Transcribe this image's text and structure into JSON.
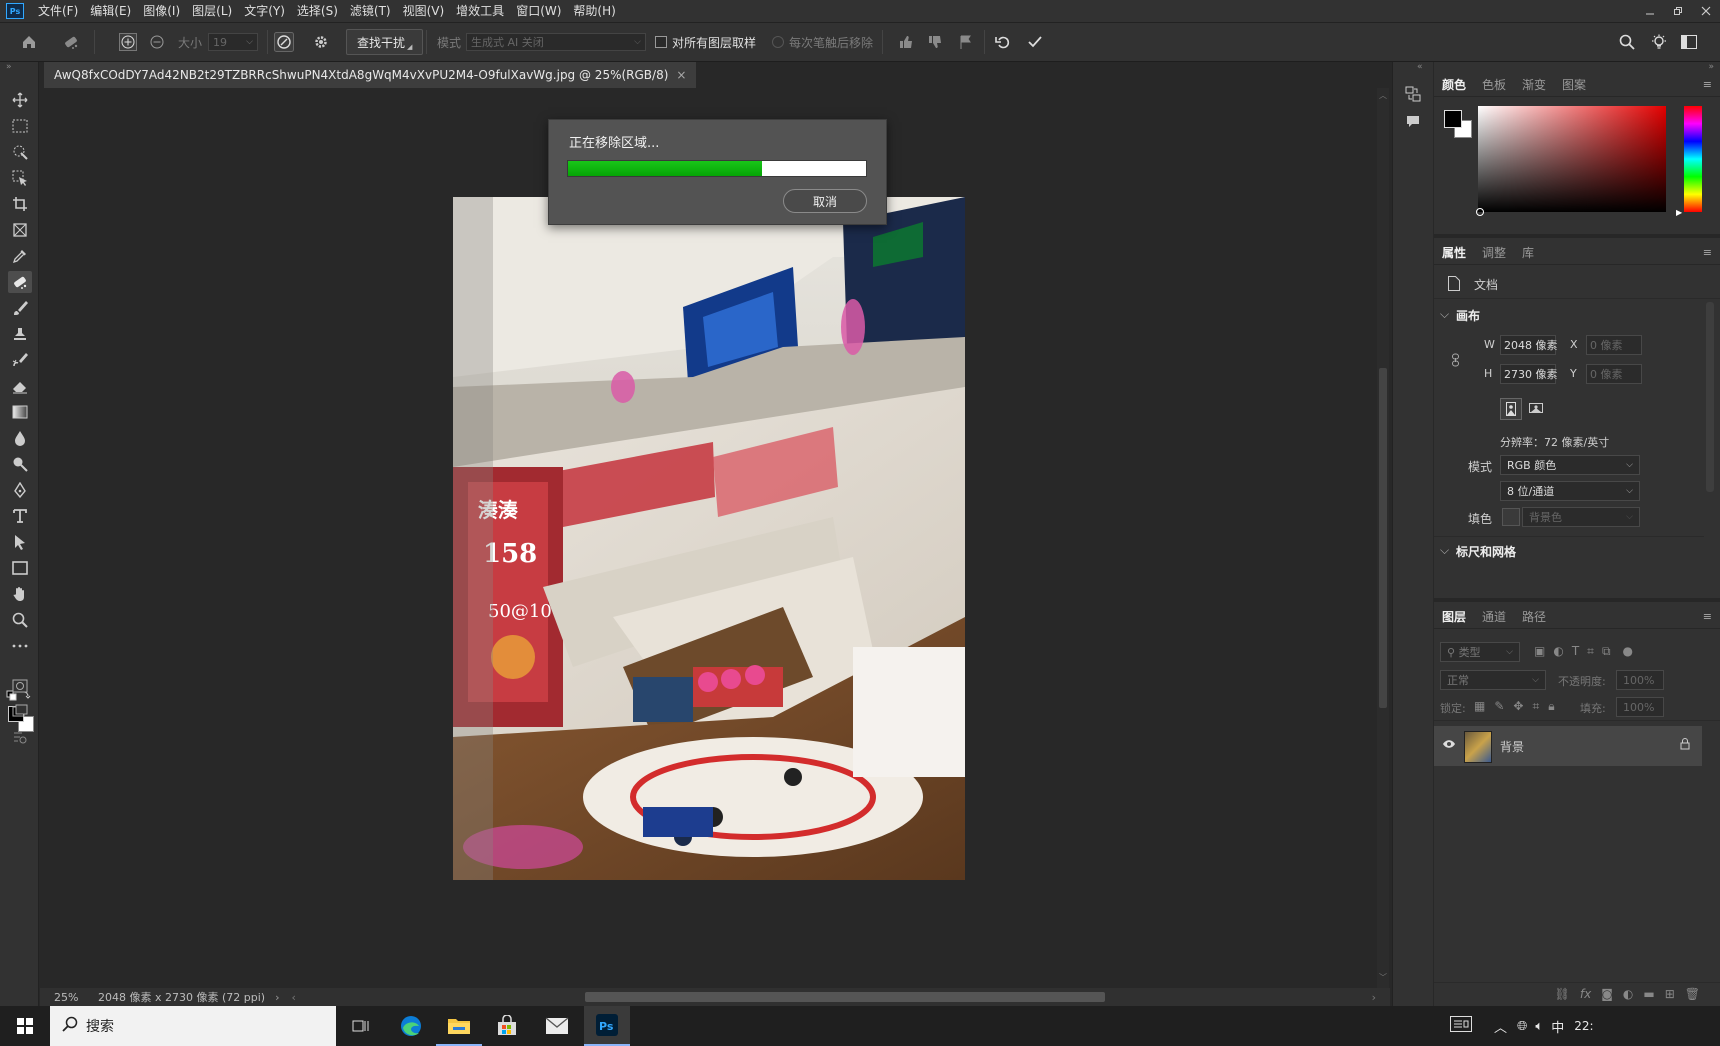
{
  "menu": {
    "items": [
      "文件(F)",
      "编辑(E)",
      "图像(I)",
      "图层(L)",
      "文字(Y)",
      "选择(S)",
      "滤镜(T)",
      "视图(V)",
      "增效工具",
      "窗口(W)",
      "帮助(H)"
    ]
  },
  "options": {
    "size_label": "大小",
    "size_value": "19",
    "find_distractions": "查找干扰",
    "mode_label": "模式",
    "mode_value": "生成式 AI 关闭",
    "sample_all_layers": "对所有图层取样",
    "remove_after_stroke": "每次笔触后移除"
  },
  "document": {
    "tab_title": "AwQ8fxCOdDY7Ad42NB2t29TZBRRcShwuPN4XtdA8gWqM4vXvPU2M4-O9fulXavWg.jpg @ 25%(RGB/8)",
    "close": "×"
  },
  "status": {
    "zoom": "25%",
    "info": "2048 像素 x 2730 像素 (72 ppi)"
  },
  "dialog": {
    "message": "正在移除区域...",
    "progress": 0.65,
    "cancel": "取消"
  },
  "color_panel": {
    "tabs": [
      "颜色",
      "色板",
      "渐变",
      "图案"
    ],
    "foreground": "#000000",
    "background": "#ffffff"
  },
  "properties": {
    "tabs": [
      "属性",
      "调整",
      "库"
    ],
    "doc_label": "文档",
    "canvas_section": "画布",
    "w_label": "W",
    "w_value": "2048 像素",
    "h_label": "H",
    "h_value": "2730 像素",
    "x_label": "X",
    "x_placeholder": "0 像素",
    "y_label": "Y",
    "y_placeholder": "0 像素",
    "resolution": "分辨率：72 像素/英寸",
    "mode_label": "模式",
    "mode_value": "RGB 颜色",
    "bit_depth": "8 位/通道",
    "fill_label": "填色",
    "fill_value": "背景色",
    "rulers_section": "标尺和网格"
  },
  "layers": {
    "tabs": [
      "图层",
      "通道",
      "路径"
    ],
    "filter_placeholder": "类型",
    "blend_mode": "正常",
    "opacity_label": "不透明度:",
    "opacity_value": "100%",
    "lock_label": "锁定:",
    "fill_label": "填充:",
    "fill_value": "100%",
    "items": [
      {
        "name": "背景"
      }
    ]
  },
  "taskbar": {
    "search_placeholder": "搜索",
    "ime": "中",
    "time": "22:"
  }
}
